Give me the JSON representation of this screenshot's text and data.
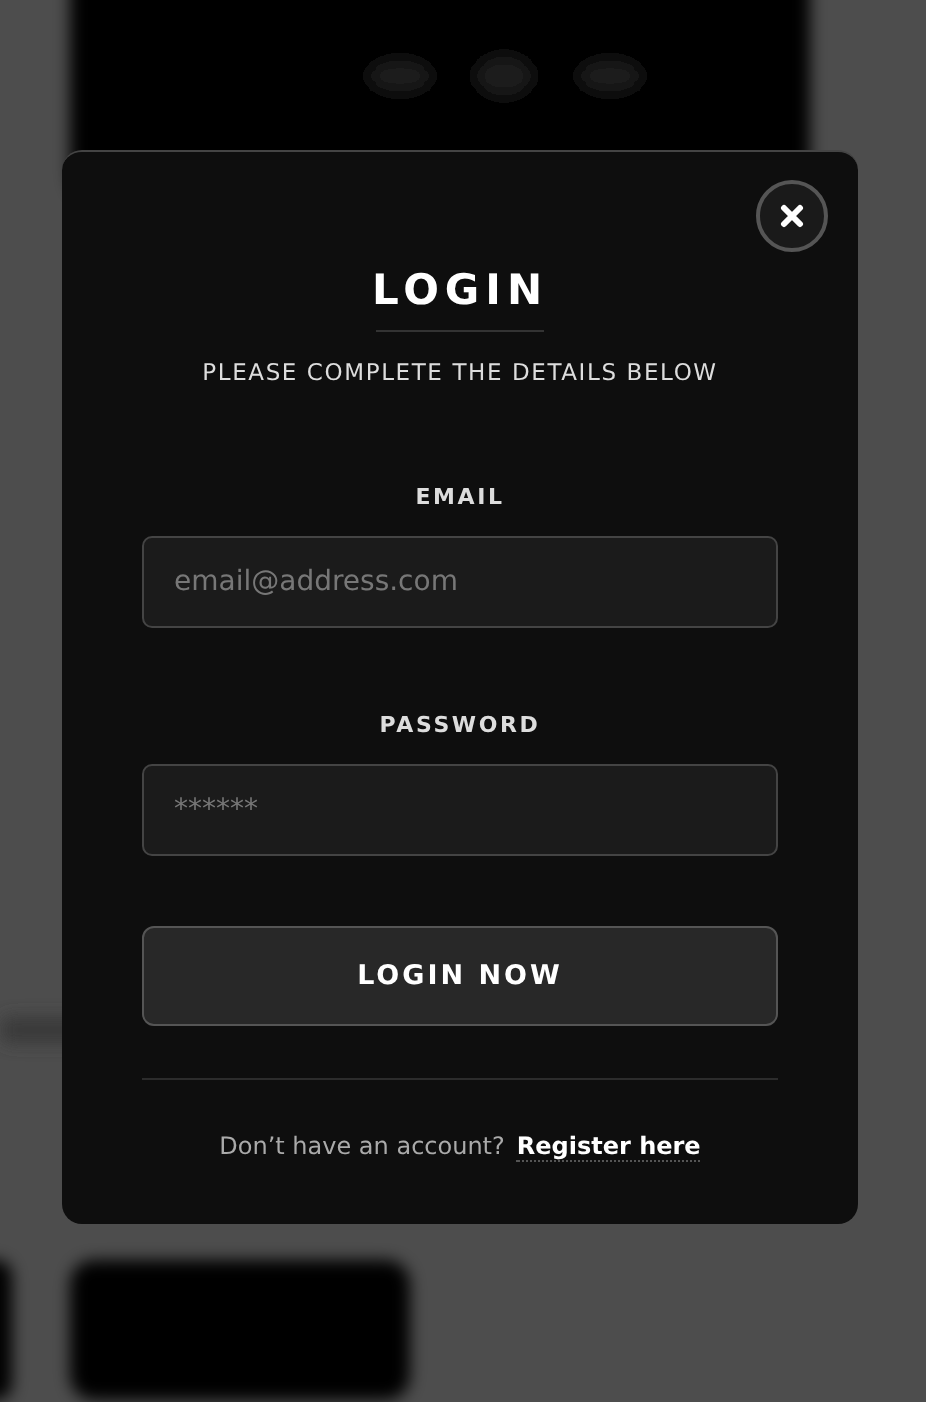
{
  "modal": {
    "title": "LOGIN",
    "subtitle": "PLEASE COMPLETE THE DETAILS BELOW",
    "fields": [
      {
        "label": "EMAIL",
        "placeholder": "email@address.com"
      },
      {
        "label": "PASSWORD",
        "placeholder": "******"
      }
    ],
    "submit": "LOGIN NOW",
    "footer": {
      "text": "Don’t have an account?",
      "link": "Register here"
    }
  }
}
